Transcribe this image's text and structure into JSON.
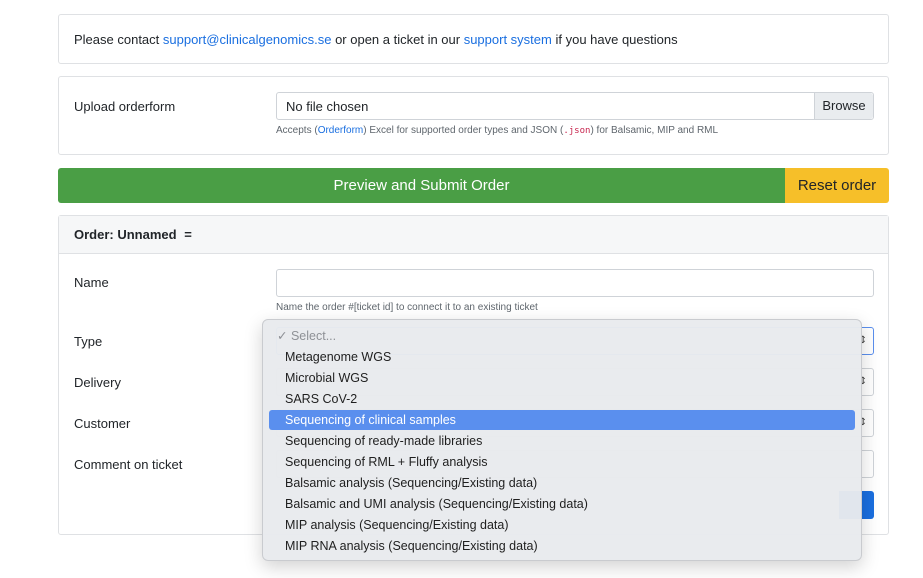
{
  "contact": {
    "prefix": "Please contact ",
    "email": "support@clinicalgenomics.se",
    "middle": " or open a ticket in our ",
    "link": "support system",
    "suffix": " if you have questions"
  },
  "upload": {
    "label": "Upload orderform",
    "file_value": "No file chosen",
    "browse_label": "Browse",
    "help_prefix": "Accepts (",
    "help_link": "Orderform",
    "help_middle": ") Excel for supported order types and JSON (",
    "help_code": ".json",
    "help_suffix": ") for Balsamic, MIP and RML"
  },
  "actions": {
    "preview_label": "Preview and Submit Order",
    "reset_label": "Reset order"
  },
  "order": {
    "title": "Order: Unnamed",
    "menu_glyph": "=",
    "name_label": "Name",
    "name_help": "Name the order #[ticket id] to connect it to an existing ticket",
    "type_label": "Type",
    "delivery_label": "Delivery",
    "customer_label": "Customer",
    "comment_label": "Comment on ticket",
    "select_arrow": "⇕"
  },
  "dropdown": {
    "placeholder": "✓ Select...",
    "selected_index": 3,
    "options": [
      "Metagenome WGS",
      "Microbial WGS",
      "SARS CoV-2",
      "Sequencing of clinical samples",
      "Sequencing of ready-made libraries",
      "Sequencing of RML + Fluffy analysis",
      "Balsamic analysis (Sequencing/Existing data)",
      "Balsamic and UMI analysis (Sequencing/Existing data)",
      "MIP analysis (Sequencing/Existing data)",
      "MIP RNA analysis (Sequencing/Existing data)"
    ]
  },
  "colors": {
    "preview": "#4a9e45",
    "reset": "#f6bf29",
    "link": "#1a6fe0",
    "highlight": "#5a8fee"
  }
}
